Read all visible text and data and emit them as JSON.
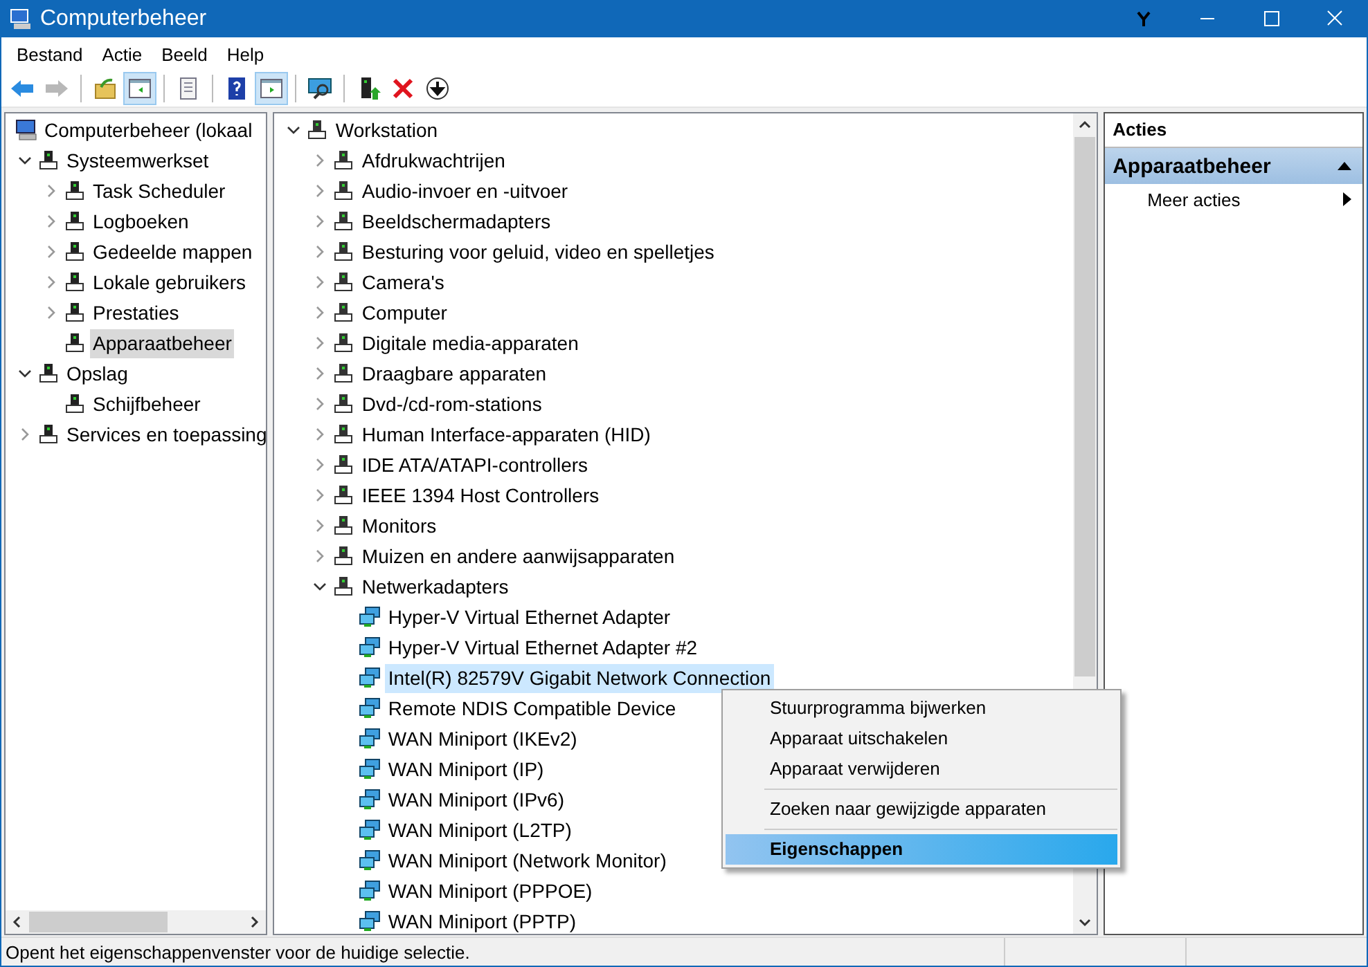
{
  "window": {
    "title": "Computerbeheer"
  },
  "menu": [
    "Bestand",
    "Actie",
    "Beeld",
    "Help"
  ],
  "toolbar": [
    [
      {
        "pressed": false,
        "disabled": false
      },
      {
        "pressed": false,
        "disabled": true
      }
    ],
    [
      {
        "pressed": false,
        "disabled": false
      },
      {
        "pressed": true,
        "disabled": false
      }
    ],
    [
      {
        "pressed": false,
        "disabled": false
      }
    ],
    [
      {
        "pressed": false,
        "disabled": false
      },
      {
        "pressed": true,
        "disabled": false
      }
    ],
    [
      {
        "pressed": false,
        "disabled": false
      }
    ],
    [
      {
        "pressed": false,
        "disabled": false
      },
      {
        "pressed": false,
        "disabled": false
      },
      {
        "pressed": false,
        "disabled": false
      }
    ]
  ],
  "console_tree": [
    {
      "label": "Computerbeheer (lokaal",
      "selected": false,
      "children": [
        {
          "label": "Systeemwerkset",
          "selected": false,
          "expanded": true,
          "children": [
            {
              "label": "Task Scheduler",
              "selected": false,
              "expanded": false
            },
            {
              "label": "Logboeken",
              "selected": false,
              "expanded": false
            },
            {
              "label": "Gedeelde mappen",
              "selected": false,
              "expanded": false
            },
            {
              "label": "Lokale gebruikers",
              "selected": false,
              "expanded": false
            },
            {
              "label": "Prestaties",
              "selected": false,
              "expanded": false
            },
            {
              "label": "Apparaatbeheer",
              "selected": true
            }
          ]
        },
        {
          "label": "Opslag",
          "selected": false,
          "expanded": true,
          "children": [
            {
              "label": "Schijfbeheer",
              "selected": false
            }
          ]
        },
        {
          "label": "Services en toepassing",
          "selected": false,
          "expanded": false
        }
      ]
    }
  ],
  "device_tree": [
    {
      "label": "Workstation",
      "selected": false,
      "expanded": true,
      "children": [
        {
          "label": "Afdrukwachtrijen",
          "selected": false,
          "expanded": false
        },
        {
          "label": "Audio-invoer en -uitvoer",
          "selected": false,
          "expanded": false
        },
        {
          "label": "Beeldschermadapters",
          "selected": false,
          "expanded": false
        },
        {
          "label": "Besturing voor geluid, video en spelletjes",
          "selected": false,
          "expanded": false
        },
        {
          "label": "Camera's",
          "selected": false,
          "expanded": false
        },
        {
          "label": "Computer",
          "selected": false,
          "expanded": false
        },
        {
          "label": "Digitale media-apparaten",
          "selected": false,
          "expanded": false
        },
        {
          "label": "Draagbare apparaten",
          "selected": false,
          "expanded": false
        },
        {
          "label": "Dvd-/cd-rom-stations",
          "selected": false,
          "expanded": false
        },
        {
          "label": "Human Interface-apparaten (HID)",
          "selected": false,
          "expanded": false
        },
        {
          "label": "IDE ATA/ATAPI-controllers",
          "selected": false,
          "expanded": false
        },
        {
          "label": "IEEE 1394 Host Controllers",
          "selected": false,
          "expanded": false
        },
        {
          "label": "Monitors",
          "selected": false,
          "expanded": false
        },
        {
          "label": "Muizen en andere aanwijsapparaten",
          "selected": false,
          "expanded": false
        },
        {
          "label": "Netwerkadapters",
          "selected": false,
          "expanded": true,
          "children": [
            {
              "label": "Hyper-V Virtual Ethernet Adapter",
              "selected": false
            },
            {
              "label": "Hyper-V Virtual Ethernet Adapter #2",
              "selected": false
            },
            {
              "label": "Intel(R) 82579V Gigabit Network Connection",
              "selected": true
            },
            {
              "label": "Remote NDIS Compatible Device",
              "selected": false
            },
            {
              "label": "WAN Miniport (IKEv2)",
              "selected": false
            },
            {
              "label": "WAN Miniport (IP)",
              "selected": false
            },
            {
              "label": "WAN Miniport (IPv6)",
              "selected": false
            },
            {
              "label": "WAN Miniport (L2TP)",
              "selected": false
            },
            {
              "label": "WAN Miniport (Network Monitor)",
              "selected": false
            },
            {
              "label": "WAN Miniport (PPPOE)",
              "selected": false
            },
            {
              "label": "WAN Miniport (PPTP)",
              "selected": false
            }
          ]
        }
      ]
    }
  ],
  "actions_pane": {
    "header": "Acties",
    "section": {
      "title": "Apparaatbeheer",
      "expanded": true,
      "items": [
        {
          "label": "Meer acties",
          "submenu": true
        }
      ]
    }
  },
  "context_menu": [
    [
      {
        "label": "Stuurprogramma bijwerken",
        "selected": false,
        "default": false
      },
      {
        "label": "Apparaat uitschakelen",
        "selected": false,
        "default": false
      },
      {
        "label": "Apparaat verwijderen",
        "selected": false,
        "default": false
      }
    ],
    [
      {
        "label": "Zoeken naar gewijzigde apparaten",
        "selected": false,
        "default": false
      }
    ],
    [
      {
        "label": "Eigenschappen",
        "selected": true,
        "default": true
      }
    ]
  ],
  "status_bar": "Opent het eigenschappenvenster voor de huidige selectie."
}
